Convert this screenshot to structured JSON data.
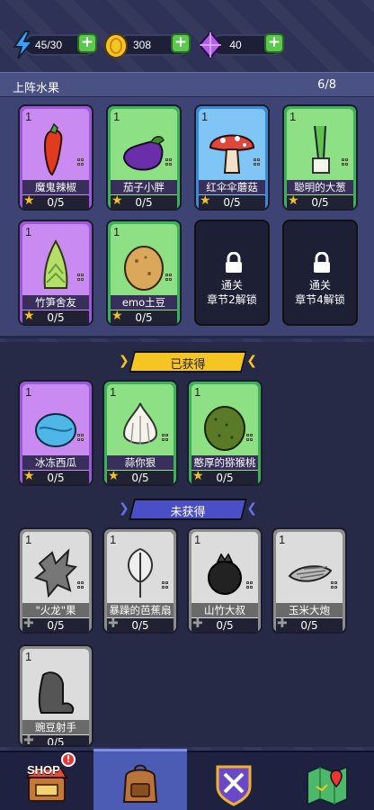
{
  "resources": {
    "energy": {
      "value": "45/30",
      "icon": "lightning-icon"
    },
    "coins": {
      "value": "308",
      "icon": "coin-icon"
    },
    "gems": {
      "value": "40",
      "icon": "gem-icon"
    }
  },
  "deployed": {
    "title": "上阵水果",
    "count": "6/8",
    "cards": [
      {
        "level": "1",
        "name": "魔鬼辣椒",
        "progress": "0/5",
        "rarity": "purple"
      },
      {
        "level": "1",
        "name": "茄子小胖",
        "progress": "0/5",
        "rarity": "green"
      },
      {
        "level": "1",
        "name": "红伞伞蘑菇",
        "progress": "0/5",
        "rarity": "blue"
      },
      {
        "level": "1",
        "name": "聪明的大葱",
        "progress": "0/5",
        "rarity": "green"
      },
      {
        "level": "1",
        "name": "竹笋舍友",
        "progress": "0/5",
        "rarity": "purple"
      },
      {
        "level": "1",
        "name": "emo土豆",
        "progress": "0/5",
        "rarity": "green"
      }
    ],
    "locked": [
      {
        "line1": "通关",
        "line2": "章节2解锁"
      },
      {
        "line1": "通关",
        "line2": "章节4解锁"
      }
    ]
  },
  "obtained": {
    "label": "已获得",
    "cards": [
      {
        "level": "1",
        "name": "冰冻西瓜",
        "progress": "0/5",
        "rarity": "purple"
      },
      {
        "level": "1",
        "name": "蒜你狠",
        "progress": "0/5",
        "rarity": "green"
      },
      {
        "level": "1",
        "name": "憨厚的猕猴桃",
        "progress": "0/5",
        "rarity": "green"
      }
    ]
  },
  "unobtained": {
    "label": "未获得",
    "cards": [
      {
        "level": "1",
        "name": "\"火龙\"果",
        "progress": "0/5"
      },
      {
        "level": "1",
        "name": "暴躁的芭蕉扇",
        "progress": "0/5"
      },
      {
        "level": "1",
        "name": "山竹大叔",
        "progress": "0/5"
      },
      {
        "level": "1",
        "name": "玉米大炮",
        "progress": "0/5"
      },
      {
        "level": "1",
        "name": "豌豆射手",
        "progress": "0/5"
      }
    ]
  },
  "nav": {
    "shop_label": "SHOP",
    "shop_badge": "!",
    "tabs": [
      "shop-icon",
      "backpack-icon",
      "battle-icon",
      "map-icon"
    ],
    "active_tab": "backpack-icon"
  },
  "colors": {
    "accent_yellow": "#f5c623",
    "accent_blue": "#5a5fd8",
    "plus_green": "#5bc84e"
  }
}
